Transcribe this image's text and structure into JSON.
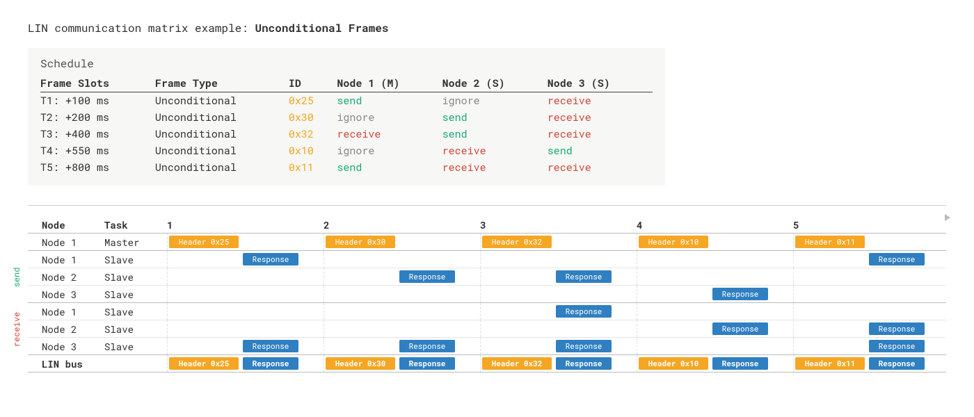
{
  "title_prefix": "LIN communication matrix example:",
  "title_emph": "Unconditional Frames",
  "schedule": {
    "label": "Schedule",
    "columns": [
      "Frame Slots",
      "Frame Type",
      "ID",
      "Node 1 (M)",
      "Node 2 (S)",
      "Node 3 (S)"
    ],
    "rows": [
      {
        "slot": "T1: +100 ms",
        "type": "Unconditional",
        "id": "0x25",
        "n1": "send",
        "n2": "ignore",
        "n3": "receive"
      },
      {
        "slot": "T2: +200 ms",
        "type": "Unconditional",
        "id": "0x30",
        "n1": "ignore",
        "n2": "send",
        "n3": "receive"
      },
      {
        "slot": "T3: +400 ms",
        "type": "Unconditional",
        "id": "0x32",
        "n1": "receive",
        "n2": "send",
        "n3": "receive"
      },
      {
        "slot": "T4: +550 ms",
        "type": "Unconditional",
        "id": "0x10",
        "n1": "ignore",
        "n2": "receive",
        "n3": "send"
      },
      {
        "slot": "T5: +800 ms",
        "type": "Unconditional",
        "id": "0x11",
        "n1": "send",
        "n2": "receive",
        "n3": "receive"
      }
    ]
  },
  "timeline": {
    "slot_ids": [
      "1",
      "2",
      "3",
      "4",
      "5"
    ],
    "col_node": "Node",
    "col_task": "Task",
    "group_send_label": "send",
    "group_recv_label": "receive",
    "headers": [
      "Header 0x25",
      "Header 0x30",
      "Header 0x32",
      "Header 0x10",
      "Header 0x11"
    ],
    "response_text": "Response",
    "bus_label": "LIN bus",
    "rows": [
      {
        "node": "Node 1",
        "task": "Master",
        "kind": "master"
      },
      {
        "node": "Node 1",
        "task": "Slave",
        "kind": "send",
        "responses": [
          true,
          false,
          false,
          false,
          true
        ]
      },
      {
        "node": "Node 2",
        "task": "Slave",
        "kind": "send",
        "responses": [
          false,
          true,
          true,
          false,
          false
        ]
      },
      {
        "node": "Node 3",
        "task": "Slave",
        "kind": "send",
        "responses": [
          false,
          false,
          false,
          true,
          false
        ]
      },
      {
        "node": "Node 1",
        "task": "Slave",
        "kind": "recv",
        "responses": [
          false,
          false,
          true,
          false,
          false
        ]
      },
      {
        "node": "Node 2",
        "task": "Slave",
        "kind": "recv",
        "responses": [
          false,
          false,
          false,
          true,
          true
        ]
      },
      {
        "node": "Node 3",
        "task": "Slave",
        "kind": "recv",
        "responses": [
          true,
          true,
          true,
          false,
          true
        ]
      }
    ]
  }
}
